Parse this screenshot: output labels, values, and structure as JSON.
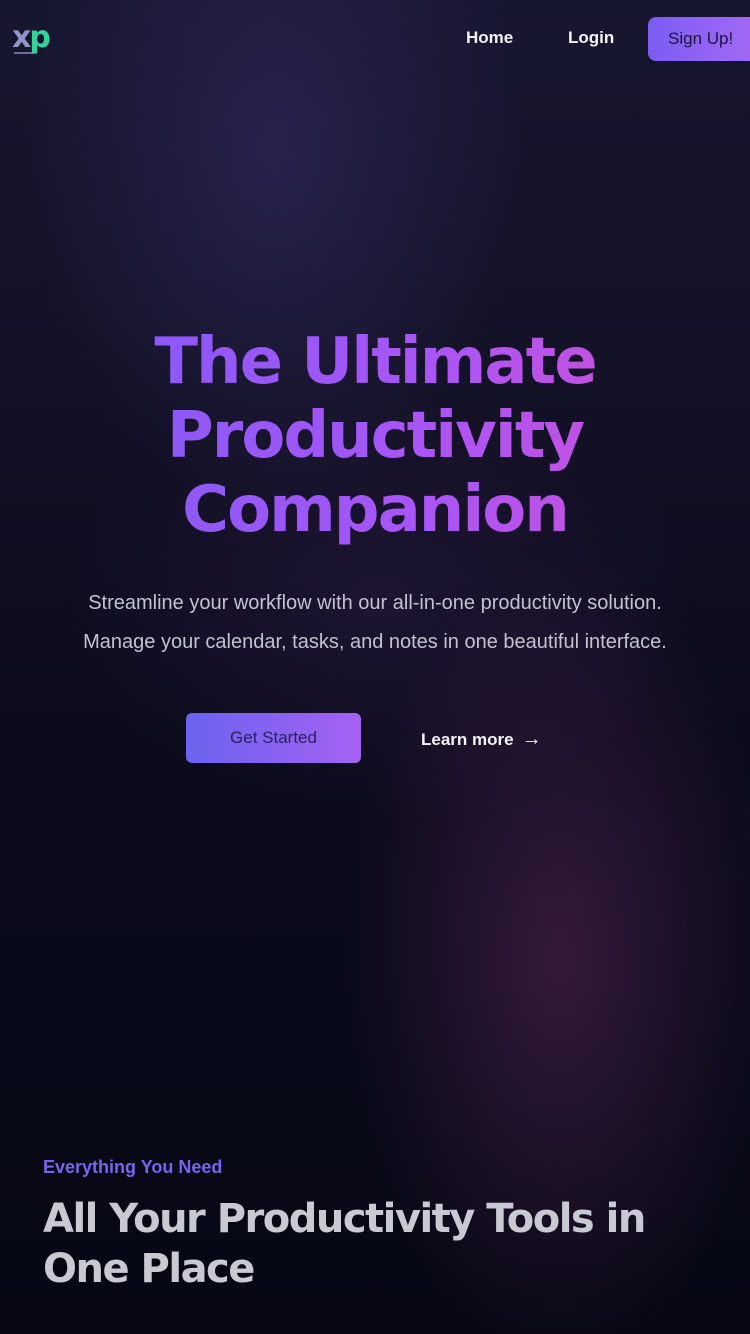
{
  "header": {
    "logo": {
      "x": "x",
      "p": "p"
    },
    "nav": {
      "home": "Home",
      "login": "Login"
    },
    "signup_label": "Sign Up!"
  },
  "hero": {
    "title_lines": [
      "The Ultimate",
      "Productivity",
      "Companion"
    ],
    "subtitle_lines": [
      "Streamline your workflow with our all-in-one productivity solution.",
      "Manage your calendar, tasks, and notes in one beautiful interface."
    ],
    "cta_primary": "Get Started",
    "cta_secondary": "Learn more",
    "cta_secondary_arrow": "→"
  },
  "features": {
    "eyebrow": "Everything You Need",
    "title": "All Your Productivity Tools in One Place"
  },
  "colors": {
    "accent": "#7c5cf3",
    "gradient_start": "#7b5cf6",
    "gradient_end": "#d64fd0",
    "logo_green": "#34d399"
  }
}
